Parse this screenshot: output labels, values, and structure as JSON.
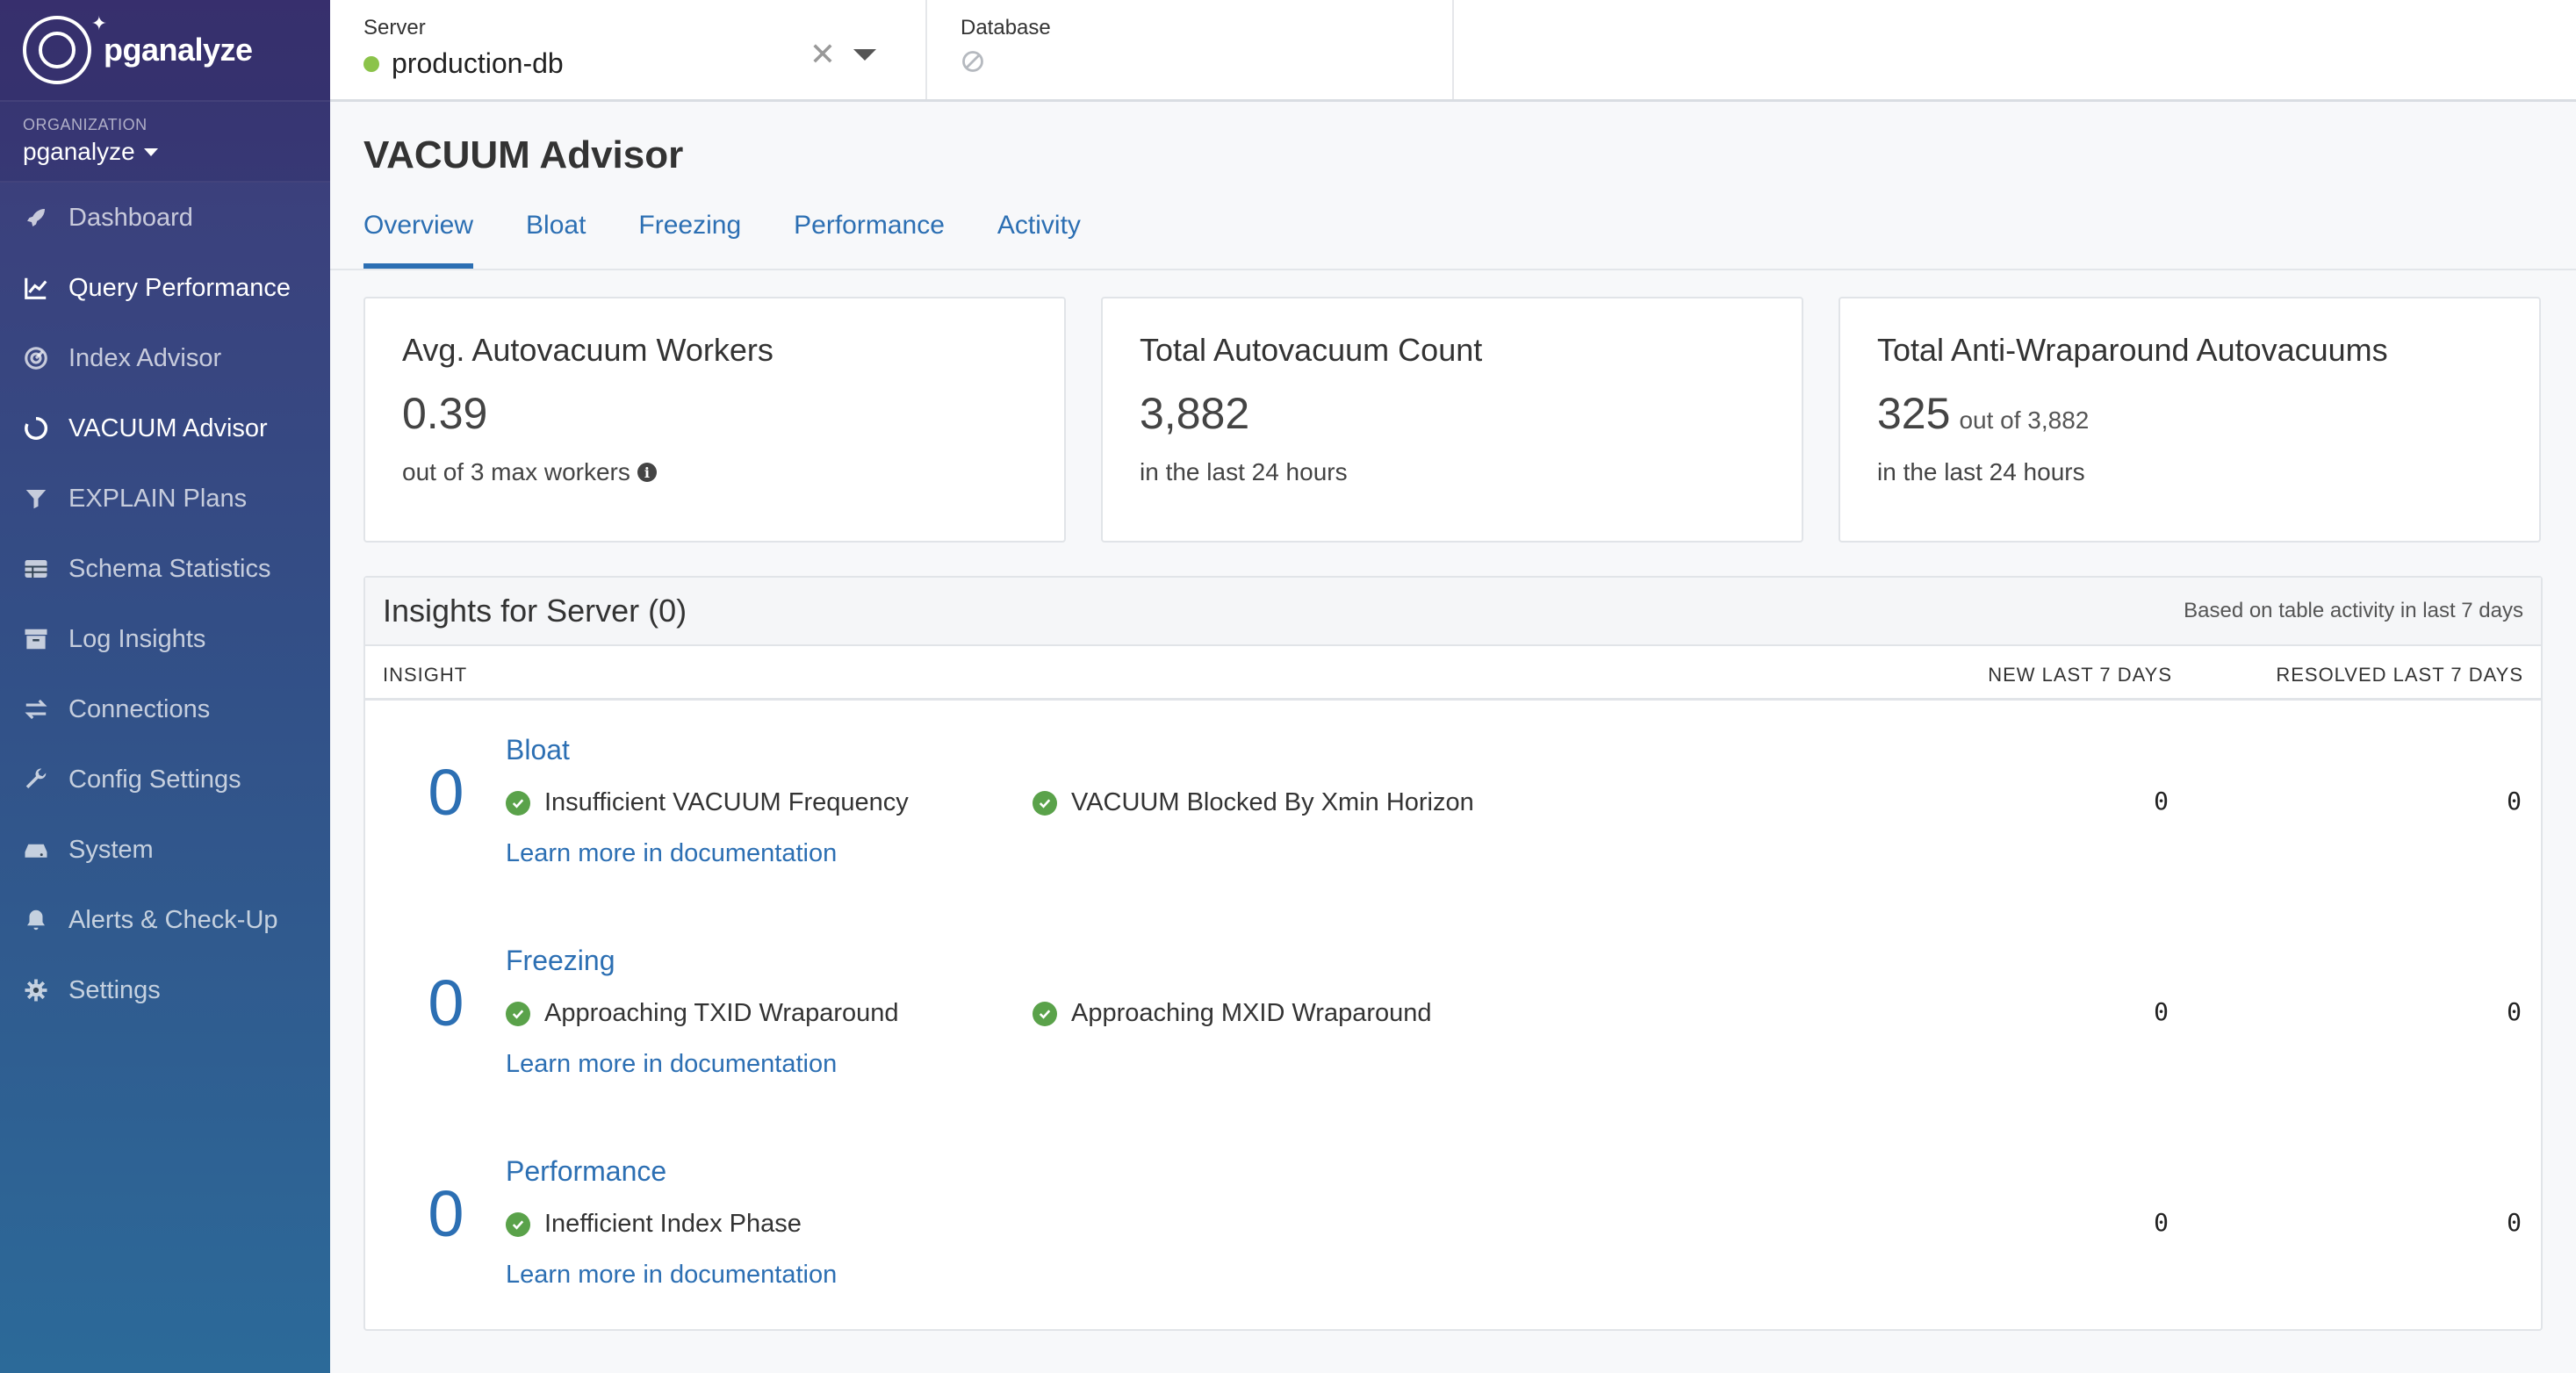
{
  "app": {
    "name": "pganalyze"
  },
  "organization": {
    "label": "ORGANIZATION",
    "name": "pganalyze"
  },
  "sidebar": {
    "items": [
      {
        "label": "Dashboard",
        "icon": "rocket-icon"
      },
      {
        "label": "Query Performance",
        "icon": "line-chart-icon"
      },
      {
        "label": "Index Advisor",
        "icon": "gauge-icon"
      },
      {
        "label": "VACUUM Advisor",
        "icon": "circle-notch-icon"
      },
      {
        "label": "EXPLAIN Plans",
        "icon": "filter-icon"
      },
      {
        "label": "Schema Statistics",
        "icon": "table-icon"
      },
      {
        "label": "Log Insights",
        "icon": "archive-icon"
      },
      {
        "label": "Connections",
        "icon": "exchange-icon"
      },
      {
        "label": "Config Settings",
        "icon": "wrench-icon"
      },
      {
        "label": "System",
        "icon": "hdd-icon"
      },
      {
        "label": "Alerts & Check-Up",
        "icon": "bell-icon"
      },
      {
        "label": "Settings",
        "icon": "gear-icon"
      }
    ],
    "active": "VACUUM Advisor"
  },
  "topbar": {
    "server": {
      "label": "Server",
      "value": "production-db",
      "status_color": "#8bc34a"
    },
    "database": {
      "label": "Database"
    }
  },
  "page": {
    "title": "VACUUM Advisor",
    "tabs": [
      "Overview",
      "Bloat",
      "Freezing",
      "Performance",
      "Activity"
    ],
    "active_tab": "Overview"
  },
  "cards": [
    {
      "title": "Avg. Autovacuum Workers",
      "value": "0.39",
      "value_suffix": "",
      "sub": "out of 3 max workers"
    },
    {
      "title": "Total Autovacuum Count",
      "value": "3,882",
      "value_suffix": "",
      "sub": "in the last 24 hours"
    },
    {
      "title": "Total Anti-Wraparound Autovacuums",
      "value": "325",
      "value_suffix": "out of 3,882",
      "sub": "in the last 24 hours"
    }
  ],
  "insights": {
    "title": "Insights for Server (0)",
    "note": "Based on table activity in last 7 days",
    "columns": {
      "insight": "INSIGHT",
      "new": "NEW LAST 7 DAYS",
      "resolved": "RESOLVED LAST 7 DAYS"
    },
    "groups": [
      {
        "count": "0",
        "name": "Bloat",
        "checks": [
          "Insufficient VACUUM Frequency",
          "VACUUM Blocked By Xmin Horizon"
        ],
        "link": "Learn more in documentation",
        "new": "0",
        "resolved": "0"
      },
      {
        "count": "0",
        "name": "Freezing",
        "checks": [
          "Approaching TXID Wraparound",
          "Approaching MXID Wraparound"
        ],
        "link": "Learn more in documentation",
        "new": "0",
        "resolved": "0"
      },
      {
        "count": "0",
        "name": "Performance",
        "checks": [
          "Inefficient Index Phase"
        ],
        "link": "Learn more in documentation",
        "new": "0",
        "resolved": "0"
      }
    ]
  },
  "colors": {
    "accent": "#2c6fb3",
    "check": "#5aa24a",
    "sidebar_top": "#3f3a78",
    "sidebar_bottom": "#2c6a99"
  }
}
